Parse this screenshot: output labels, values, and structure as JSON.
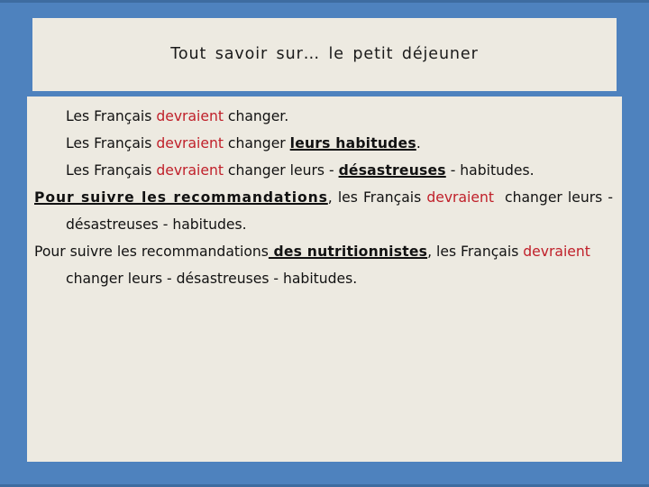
{
  "slide": {
    "background_color": "#4E82BE",
    "panel_color": "#EDEAE1",
    "accent_red": "#C0202A",
    "text_color": "#121212"
  },
  "title": {
    "text": "Tout  savoir  sur… le  petit  déjeuner"
  },
  "body": {
    "lines": [
      {
        "id": "line1",
        "plain": "Les Français devraient changer.",
        "segments": [
          {
            "text": "Les Français ",
            "style": "normal"
          },
          {
            "text": "devraient",
            "style": "red"
          },
          {
            "text": " changer.",
            "style": "normal"
          }
        ]
      },
      {
        "id": "line2",
        "plain": "Les Français devraient changer leurs habitudes.",
        "segments": [
          {
            "text": "Les Français ",
            "style": "normal"
          },
          {
            "text": "devraient",
            "style": "red"
          },
          {
            "text": " changer ",
            "style": "normal"
          },
          {
            "text": "leurs habitudes",
            "style": "bold-underline"
          },
          {
            "text": ".",
            "style": "normal"
          }
        ]
      },
      {
        "id": "line3",
        "plain": "Les Français devraient changer leurs - désastreuses - habitudes.",
        "segments": [
          {
            "text": "Les Français ",
            "style": "normal"
          },
          {
            "text": "devraient",
            "style": "red"
          },
          {
            "text": " changer leurs - ",
            "style": "normal"
          },
          {
            "text": "désastreuses",
            "style": "bold-underline"
          },
          {
            "text": " - habitudes.",
            "style": "normal"
          }
        ]
      },
      {
        "id": "line4",
        "plain": "Pour suivre les recommandations, les Français devraient changer leurs - désastreuses - habitudes.",
        "segments": [
          {
            "text": "Pour suivre les recommandations",
            "style": "bold-underline-wide"
          },
          {
            "text": ", les Français ",
            "style": "normal"
          },
          {
            "text": "devraient",
            "style": "red"
          },
          {
            "text": " changer leurs - désastreuses - habitudes.",
            "style": "normal"
          }
        ]
      },
      {
        "id": "line5",
        "plain": "Pour suivre les recommandations des nutritionnistes, les Français devraient changer leurs - désastreuses - habitudes.",
        "segments": [
          {
            "text": "Pour suivre les recommandations",
            "style": "normal"
          },
          {
            "text": " des nutritionnistes",
            "style": "bold-underline"
          },
          {
            "text": ", les Français ",
            "style": "normal"
          },
          {
            "text": "devraient",
            "style": "red"
          },
          {
            "text": " changer leurs - désastreuses - habitudes.",
            "style": "normal"
          }
        ]
      }
    ]
  }
}
